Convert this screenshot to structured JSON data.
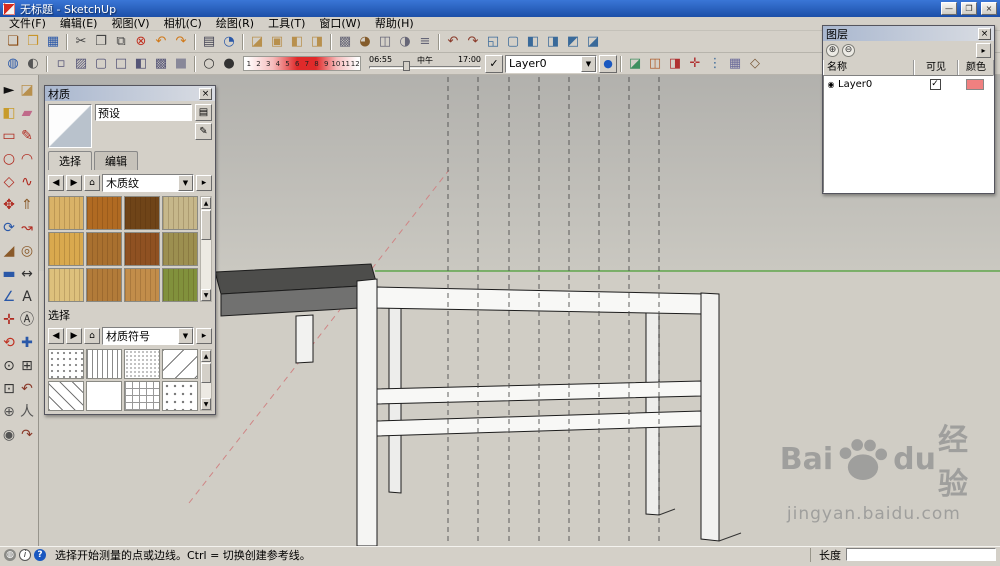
{
  "window": {
    "title": "无标题 - SketchUp"
  },
  "icons": {
    "minimize": "—",
    "maximize": "❐",
    "close": "×",
    "panel_close": "×",
    "back": "◀",
    "forward": "▶",
    "home": "⌂",
    "dropdown": "▼",
    "detail": "▸",
    "up": "▲",
    "down": "▼",
    "plus": "⊕",
    "minus": "⊖",
    "check": "✓",
    "radio": "◉",
    "screen": "▤",
    "sample": "✎",
    "layer_color_dot": "●"
  },
  "menu": {
    "items": [
      "文件(F)",
      "编辑(E)",
      "视图(V)",
      "相机(C)",
      "绘图(R)",
      "工具(T)",
      "窗口(W)",
      "帮助(H)"
    ]
  },
  "toolbar1": {
    "icons": [
      {
        "name": "new-icon",
        "g": "❏",
        "c": "#8a4a10"
      },
      {
        "name": "open-icon",
        "g": "❒",
        "c": "#c8952a"
      },
      {
        "name": "save-icon",
        "g": "▦",
        "c": "#2a58a8"
      },
      {
        "name": "separator",
        "cls": "sep",
        "inter": "false"
      },
      {
        "name": "cut-icon",
        "g": "✂",
        "c": "#444444"
      },
      {
        "name": "copy-icon",
        "g": "❐",
        "c": "#444444"
      },
      {
        "name": "paste-icon",
        "g": "⧉",
        "c": "#444444"
      },
      {
        "name": "delete-icon",
        "g": "⊗",
        "c": "#c03020"
      },
      {
        "name": "undo-icon",
        "g": "↶",
        "c": "#d07818"
      },
      {
        "name": "redo-icon",
        "g": "↷",
        "c": "#d07818"
      },
      {
        "name": "separator",
        "cls": "sep",
        "inter": "false"
      },
      {
        "name": "print-icon",
        "g": "▤",
        "c": "#444455"
      },
      {
        "name": "model-info-icon",
        "g": "◔",
        "c": "#2a58a8"
      },
      {
        "name": "separator",
        "cls": "sep",
        "inter": "false"
      },
      {
        "name": "make-component-icon",
        "g": "◪",
        "c": "#b8904d"
      },
      {
        "name": "group-icon",
        "g": "▣",
        "c": "#b8904d"
      },
      {
        "name": "edit-component-icon",
        "g": "◧",
        "c": "#b8904d"
      },
      {
        "name": "explode-icon",
        "g": "◨",
        "c": "#b8904d"
      },
      {
        "name": "separator",
        "cls": "sep",
        "inter": "false"
      },
      {
        "name": "entity-info-icon",
        "g": "▩",
        "c": "#666677"
      },
      {
        "name": "materials-browser-icon",
        "g": "◕",
        "c": "#845c2c"
      },
      {
        "name": "components-browser-icon",
        "g": "◫",
        "c": "#666677"
      },
      {
        "name": "styles-browser-icon",
        "g": "◑",
        "c": "#666677"
      },
      {
        "name": "layers-browser-icon",
        "g": "≡",
        "c": "#666677"
      },
      {
        "name": "separator",
        "cls": "sep",
        "inter": "false"
      },
      {
        "name": "camera-previous-icon",
        "g": "↶",
        "c": "#8a3a2a"
      },
      {
        "name": "camera-next-icon",
        "g": "↷",
        "c": "#8a3a2a"
      },
      {
        "name": "iso-view-icon",
        "g": "◱",
        "c": "#3a6a9a"
      },
      {
        "name": "top-view-icon",
        "g": "▢",
        "c": "#3a6a9a"
      },
      {
        "name": "front-view-icon",
        "g": "◧",
        "c": "#3a6a9a"
      },
      {
        "name": "right-view-icon",
        "g": "◨",
        "c": "#3a6a9a"
      },
      {
        "name": "back-view-icon",
        "g": "◩",
        "c": "#3a6a9a"
      },
      {
        "name": "left-view-icon",
        "g": "◪",
        "c": "#3a6a9a"
      }
    ]
  },
  "toolbar2": {
    "left_icons": [
      {
        "name": "display-mode-icon",
        "g": "◍",
        "c": "#2a58a8"
      },
      {
        "name": "shadow-dialog-icon",
        "g": "◐",
        "c": "#555555"
      }
    ],
    "style_icons": [
      {
        "name": "xray-icon",
        "g": "▫",
        "c": "#555577"
      },
      {
        "name": "back-edges-icon",
        "g": "▨",
        "c": "#555577"
      },
      {
        "name": "wireframe-icon",
        "g": "▢",
        "c": "#555577"
      },
      {
        "name": "hidden-line-icon",
        "g": "□",
        "c": "#555577"
      },
      {
        "name": "shaded-icon",
        "g": "◧",
        "c": "#555577"
      },
      {
        "name": "shaded-textures-icon",
        "g": "▩",
        "c": "#555577"
      },
      {
        "name": "monochrome-icon",
        "g": "■",
        "c": "#888899"
      }
    ],
    "shadow_icons": [
      {
        "name": "shadows-toggle-icon",
        "g": "○",
        "c": "#333333"
      },
      {
        "name": "fog-toggle-icon",
        "g": "●",
        "c": "#333333"
      }
    ],
    "month_numbers": [
      "1",
      "2",
      "3",
      "4",
      "5",
      "6",
      "7",
      "8",
      "9",
      "10",
      "11",
      "12"
    ],
    "time_start": "06:55",
    "time_noon": "中午",
    "time_end": "17:00",
    "layer_select": "Layer0",
    "right_icons": [
      {
        "name": "section-plane-icon",
        "g": "◪",
        "c": "#3f8f5f"
      },
      {
        "name": "section-display-icon",
        "g": "◫",
        "c": "#b06030"
      },
      {
        "name": "section-cut-icon",
        "g": "◨",
        "c": "#b03030"
      },
      {
        "name": "axes-toggle-icon",
        "g": "✛",
        "c": "#b03030"
      },
      {
        "name": "guides-toggle-icon",
        "g": "⋮",
        "c": "#3a6a9a"
      },
      {
        "name": "hidden-geometry-icon",
        "g": "▦",
        "c": "#6a6a9a"
      },
      {
        "name": "unit-settings-icon",
        "g": "◇",
        "c": "#7a5a3a"
      }
    ]
  },
  "left_toolbar": {
    "tools": [
      {
        "name": "select-tool",
        "g": "►",
        "c": "#111111"
      },
      {
        "name": "make-component-tool",
        "g": "◪",
        "c": "#b8904d"
      },
      {
        "name": "paint-bucket-tool",
        "g": "◧",
        "c": "#c89b2a"
      },
      {
        "name": "eraser-tool",
        "g": "▰",
        "c": "#c06a8a"
      },
      {
        "name": "rectangle-tool",
        "g": "▭",
        "c": "#b02a20"
      },
      {
        "name": "line-tool",
        "g": "✎",
        "c": "#b02a20"
      },
      {
        "name": "circle-tool",
        "g": "○",
        "c": "#b02a20"
      },
      {
        "name": "arc-tool",
        "g": "◠",
        "c": "#b02a20"
      },
      {
        "name": "polygon-tool",
        "g": "◇",
        "c": "#b02a20"
      },
      {
        "name": "freehand-tool",
        "g": "∿",
        "c": "#b02a20"
      },
      {
        "name": "move-tool",
        "g": "✥",
        "c": "#b02a20"
      },
      {
        "name": "push-pull-tool",
        "g": "⇑",
        "c": "#8a5a2a"
      },
      {
        "name": "rotate-tool",
        "g": "⟳",
        "c": "#2a58a8"
      },
      {
        "name": "follow-me-tool",
        "g": "↝",
        "c": "#b02a20"
      },
      {
        "name": "scale-tool",
        "g": "◢",
        "c": "#8a5a2a"
      },
      {
        "name": "offset-tool",
        "g": "◎",
        "c": "#8a5a2a"
      },
      {
        "name": "tape-measure-tool",
        "g": "▬",
        "c": "#2a58a8"
      },
      {
        "name": "dimension-tool",
        "g": "↔",
        "c": "#333333"
      },
      {
        "name": "protractor-tool",
        "g": "∠",
        "c": "#2a58a8"
      },
      {
        "name": "text-tool",
        "g": "A",
        "c": "#333333"
      },
      {
        "name": "axes-tool",
        "g": "✛",
        "c": "#b02a20"
      },
      {
        "name": "3d-text-tool",
        "g": "Ⓐ",
        "c": "#333333"
      },
      {
        "name": "orbit-tool",
        "g": "⟲",
        "c": "#c03020"
      },
      {
        "name": "pan-tool",
        "g": "✚",
        "c": "#2a58a8"
      },
      {
        "name": "zoom-tool",
        "g": "⊙",
        "c": "#333333"
      },
      {
        "name": "zoom-window-tool",
        "g": "⊞",
        "c": "#333333"
      },
      {
        "name": "zoom-extents-tool",
        "g": "⊡",
        "c": "#333333"
      },
      {
        "name": "previous-view-tool",
        "g": "↶",
        "c": "#8a3a2a"
      },
      {
        "name": "position-camera-tool",
        "g": "⊕",
        "c": "#555555"
      },
      {
        "name": "walk-tool",
        "g": "人",
        "c": "#555555"
      },
      {
        "name": "look-around-tool",
        "g": "◉",
        "c": "#555555"
      },
      {
        "name": "next-view-tool",
        "g": "↷",
        "c": "#8a3a2a"
      }
    ]
  },
  "materials_panel": {
    "title": "材质",
    "preview_name": "预设",
    "tabs": [
      {
        "label": "选择",
        "state": "active"
      },
      {
        "label": "编辑",
        "state": ""
      }
    ],
    "dropdown1": "木质纹",
    "section2_label": "选择",
    "dropdown2": "材质符号",
    "wood_swatches": [
      {
        "name": "wood-swatch-1",
        "color": "#d9b267"
      },
      {
        "name": "wood-swatch-2",
        "color": "#b06a22"
      },
      {
        "name": "wood-swatch-3",
        "color": "#6f4418"
      },
      {
        "name": "wood-swatch-4",
        "color": "#c6b78a"
      },
      {
        "name": "wood-swatch-5",
        "color": "#d9a94e"
      },
      {
        "name": "wood-swatch-6",
        "color": "#a9702f"
      },
      {
        "name": "wood-swatch-7",
        "color": "#8f5122"
      },
      {
        "name": "wood-swatch-8",
        "color": "#9c8f50"
      },
      {
        "name": "wood-swatch-9",
        "color": "#ddc07c"
      },
      {
        "name": "wood-swatch-10",
        "color": "#b27b39"
      },
      {
        "name": "wood-swatch-11",
        "color": "#c28d4a"
      },
      {
        "name": "wood-swatch-12",
        "color": "#81913c"
      }
    ],
    "pattern_swatches": [
      {
        "name": "pattern-dots",
        "cls": "p-dots"
      },
      {
        "name": "pattern-vlines",
        "cls": "p-vlines"
      },
      {
        "name": "pattern-fine-dots",
        "cls": "p-dots2"
      },
      {
        "name": "pattern-diagonal",
        "cls": "p-diag"
      },
      {
        "name": "pattern-diagonal-steep",
        "cls": "p-diag2"
      },
      {
        "name": "pattern-blank",
        "cls": "p-blank"
      },
      {
        "name": "pattern-grid",
        "cls": "p-grid"
      },
      {
        "name": "pattern-speckle",
        "cls": "p-dots3"
      }
    ]
  },
  "layers_panel": {
    "title": "图层",
    "columns": [
      "名称",
      "可见",
      "颜色"
    ],
    "layers": [
      {
        "name": "Layer0",
        "visible": true,
        "color": "#f08080"
      }
    ]
  },
  "statusbar": {
    "icons": [
      {
        "name": "geolocate-icon",
        "g": "◍",
        "cls": "sbc1"
      },
      {
        "name": "credits-icon",
        "g": "i",
        "cls": "sbc2"
      },
      {
        "name": "help-icon",
        "g": "?",
        "cls": "sbc3"
      }
    ],
    "message": "选择开始测量的点或边线。Ctrl = 切换创建参考线。",
    "measure_label": "长度",
    "measure_value": ""
  },
  "watermark": {
    "brand_prefix": "Bai",
    "brand_suffix": "du",
    "brand_cn": "经验",
    "url": "jingyan.baidu.com"
  },
  "colors": {
    "titlebar": "#2a63c8",
    "axis_green": "#4a9e35",
    "axis_red": "#cf8585",
    "layer_swatch": "#f08080"
  }
}
